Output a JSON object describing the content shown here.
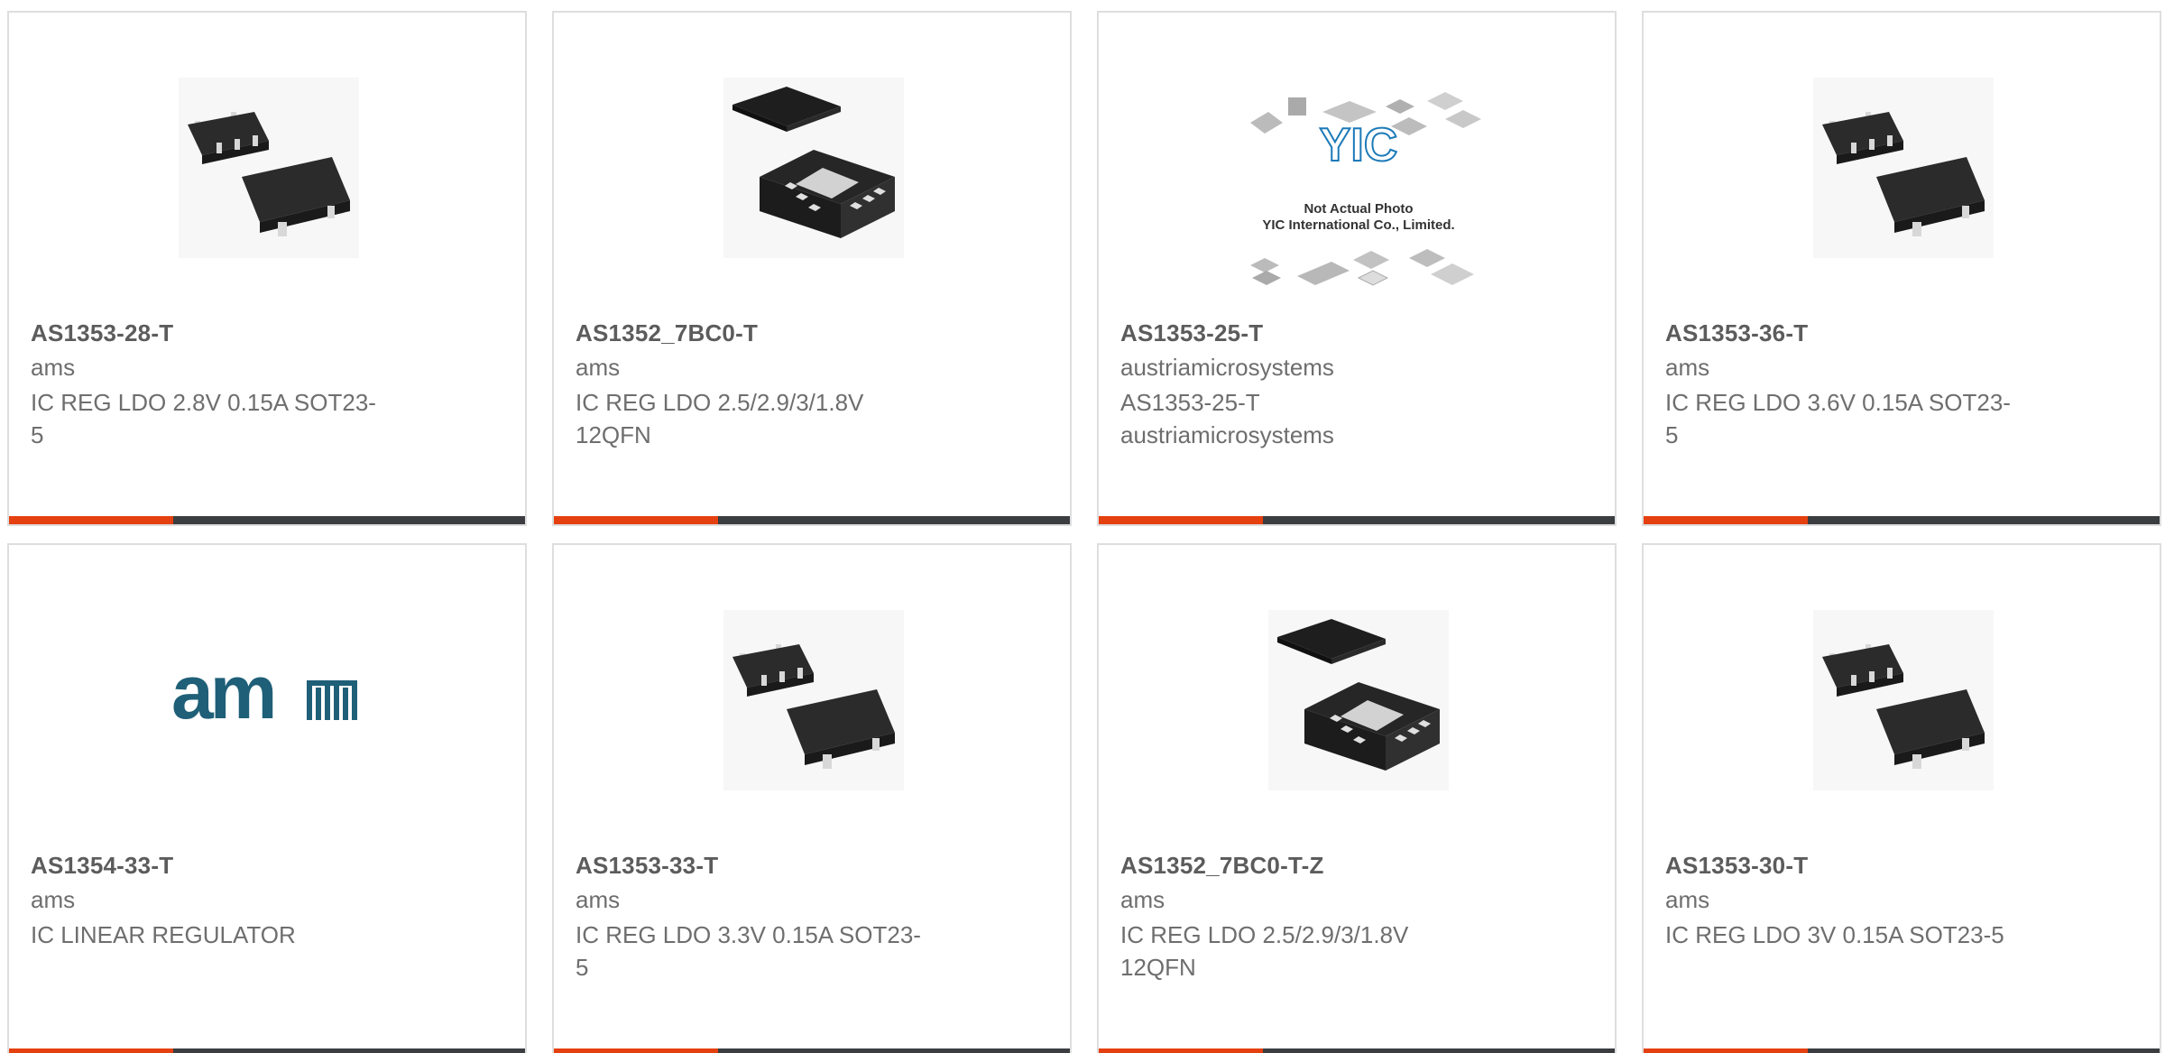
{
  "colors": {
    "accent": "#e5400f",
    "bar": "#3b3d40",
    "border": "#dedede",
    "title": "#5c5c5c",
    "text": "#6e6e6e",
    "ams_logo": "#1f5f78"
  },
  "cards": [
    {
      "part": "AS1353-28-T",
      "manufacturer": "ams",
      "description": "IC REG LDO 2.8V 0.15A SOT23-\n5",
      "image": "sot23-package-photo"
    },
    {
      "part": "AS1352_7BC0-T",
      "manufacturer": "ams",
      "description": "IC REG LDO 2.5/2.9/3/1.8V\n12QFN",
      "image": "qfn-package-photo"
    },
    {
      "part": "AS1353-25-T",
      "manufacturer": "austriamicrosystems",
      "description": "AS1353-25-T\naustriamicrosystems",
      "image": "yic-placeholder-photo",
      "placeholder_line1": "Not Actual Photo",
      "placeholder_line2": "YIC International Co., Limited.",
      "placeholder_logo": "YIC"
    },
    {
      "part": "AS1353-36-T",
      "manufacturer": "ams",
      "description": "IC REG LDO 3.6V 0.15A SOT23-\n5",
      "image": "sot23-package-photo"
    },
    {
      "part": "AS1354-33-T",
      "manufacturer": "ams",
      "description": "IC LINEAR REGULATOR",
      "image": "ams-logo",
      "logo_text": "am"
    },
    {
      "part": "AS1353-33-T",
      "manufacturer": "ams",
      "description": "IC REG LDO 3.3V 0.15A SOT23-\n5",
      "image": "sot23-package-photo"
    },
    {
      "part": "AS1352_7BC0-T-Z",
      "manufacturer": "ams",
      "description": "IC REG LDO 2.5/2.9/3/1.8V\n12QFN",
      "image": "qfn-package-photo"
    },
    {
      "part": "AS1353-30-T",
      "manufacturer": "ams",
      "description": "IC REG LDO 3V 0.15A SOT23-5",
      "image": "sot23-package-photo"
    }
  ]
}
